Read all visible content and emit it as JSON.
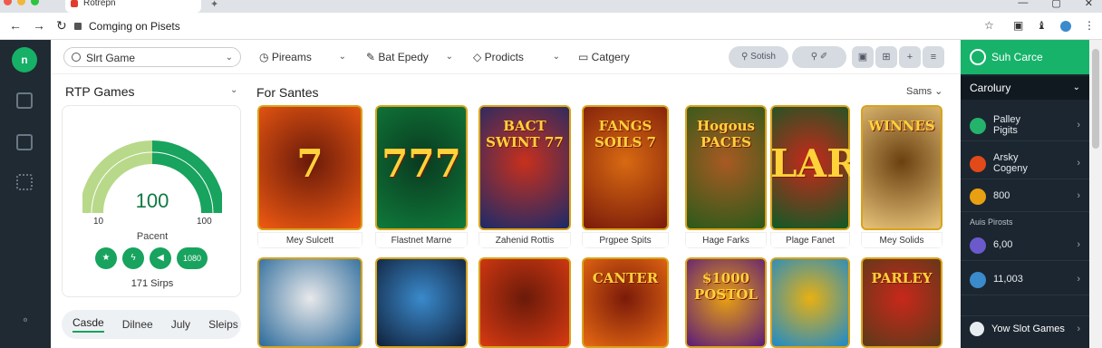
{
  "browser": {
    "tab_title": "Rotrepn",
    "address": "Comging on Pisets"
  },
  "filters": {
    "search": "Slrt Game",
    "f1": "Pireams",
    "f2": "Bat Epedy",
    "f3": "Prodicts",
    "f4": "Catgery",
    "action": "Sotish"
  },
  "rtp": {
    "title": "RTP Games",
    "value": "100",
    "min": "10",
    "max": "100",
    "label": "Pacent",
    "chip": "1080",
    "spins": "171 Sirps",
    "tabs": [
      "Casde",
      "Dilnee",
      "July",
      "Sleips"
    ]
  },
  "grid": {
    "title": "For Santes",
    "sort": "Sams",
    "row1": [
      {
        "name": "Mey Sulcett",
        "glyph": "7",
        "colors": [
          "#f05a12",
          "#6a1a0a"
        ]
      },
      {
        "name": "Flastnet Marne",
        "glyph": "777",
        "colors": [
          "#0f7a3a",
          "#0a3a20"
        ]
      },
      {
        "name": "Zahenid Rottis",
        "glyph": "BACT SWINT 77",
        "colors": [
          "#1a2a6a",
          "#c8301c"
        ]
      },
      {
        "name": "Prgpee Spits",
        "glyph": "FANGS SOILS 7",
        "colors": [
          "#7a1a0a",
          "#d86a12"
        ]
      },
      {
        "name": "Hage Farks",
        "glyph": "Hogous PACES",
        "colors": [
          "#2a5a1a",
          "#a85a22"
        ]
      },
      {
        "name": "Plage Fanet",
        "glyph": "LARS",
        "colors": [
          "#0e5a26",
          "#c8281a"
        ]
      },
      {
        "name": "Mey Solids",
        "glyph": "WINNES",
        "colors": [
          "#e8c47a",
          "#6a4010"
        ]
      }
    ],
    "row2": [
      {
        "glyph": "",
        "colors": [
          "#2a6a9a",
          "#e8e8ea"
        ]
      },
      {
        "glyph": "",
        "colors": [
          "#10203a",
          "#3a8acc"
        ]
      },
      {
        "glyph": "",
        "colors": [
          "#d83a12",
          "#6a1a0a"
        ]
      },
      {
        "glyph": "CANTER",
        "colors": [
          "#e86a12",
          "#7a1a0a"
        ]
      },
      {
        "glyph": "$1000 POSTOL",
        "colors": [
          "#5a1a7a",
          "#e8a012"
        ]
      },
      {
        "glyph": "",
        "colors": [
          "#1a8acc",
          "#e8b012"
        ]
      },
      {
        "glyph": "PARLEY",
        "colors": [
          "#5a3a1a",
          "#c8281a"
        ]
      }
    ]
  },
  "right": {
    "head": "Suh Carce",
    "category": "Carolury",
    "items": [
      {
        "line1": "Palley",
        "line2": "Pigits",
        "color": "#24b36b"
      },
      {
        "line1": "Arsky",
        "line2": "Cogeny",
        "color": "#e24a1a"
      },
      {
        "line1": "800",
        "line2": "",
        "color": "#e8a012"
      },
      {
        "line1": "6,00",
        "line2": "",
        "color": "#6a5acc"
      },
      {
        "line1": "11,003",
        "line2": "",
        "color": "#3a8acc"
      }
    ],
    "sub": "Auis Pirosts",
    "footer": "Yow Slot Games"
  }
}
